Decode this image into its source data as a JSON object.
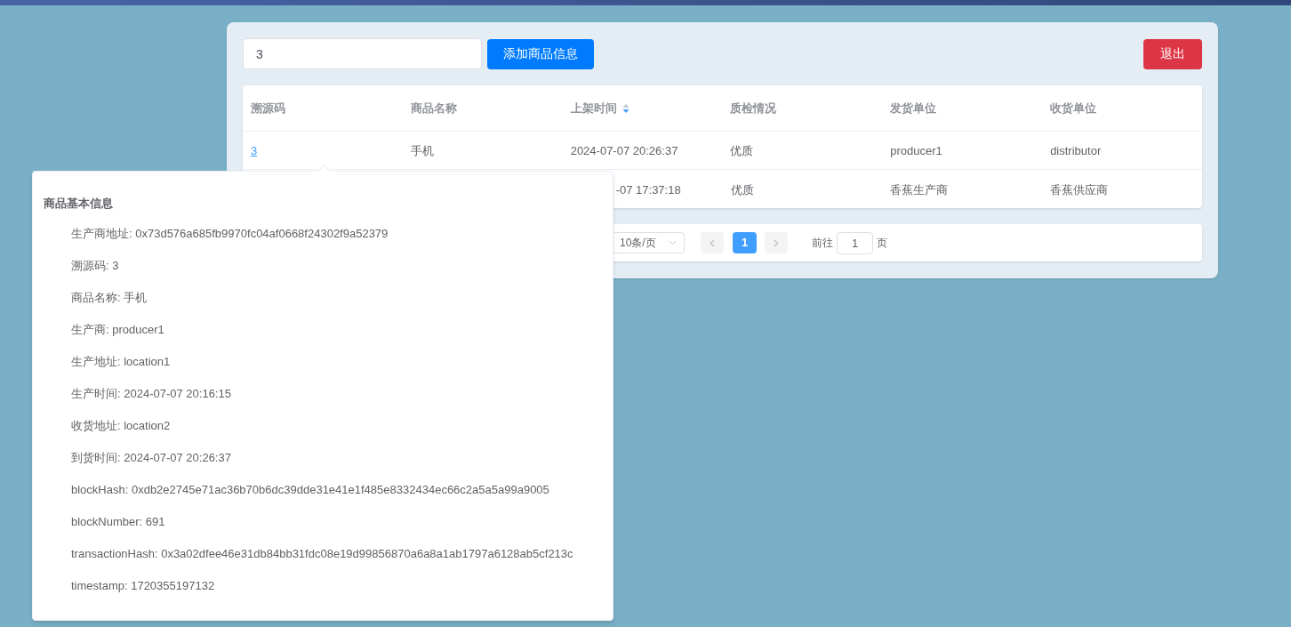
{
  "search": {
    "value": "3"
  },
  "add_button": "添加商品信息",
  "exit_button": "退出",
  "table": {
    "columns": [
      {
        "label": "溯源码"
      },
      {
        "label": "商品名称"
      },
      {
        "label": "上架时间",
        "sort_descending": true
      },
      {
        "label": "质检情况"
      },
      {
        "label": "发货单位"
      },
      {
        "label": "收货单位"
      }
    ],
    "rows": [
      {
        "cells": [
          "3",
          "手机",
          "2024-07-07 20:26:37",
          "优质",
          "producer1",
          "distributor"
        ]
      },
      {
        "cells": [
          "",
          "",
          "-07 17:37:18",
          "优质",
          "香蕉生产商",
          "香蕉供应商"
        ]
      }
    ]
  },
  "pagination": {
    "page_size": "10条/页",
    "pages": [
      {
        "label": "1",
        "selected": true
      }
    ],
    "jump_label": "前往",
    "jump_value": "1",
    "jump_suffix": "页"
  },
  "popover": {
    "title": "商品基本信息",
    "items": [
      "生产商地址: 0x73d576a685fb9970fc04af0668f24302f9a52379",
      "溯源码: 3",
      "商品名称: 手机",
      "生产商: producer1",
      "生产地址: location1",
      "生产时间: 2024-07-07 20:16:15",
      "收货地址: location2",
      "到货时间: 2024-07-07 20:26:37",
      "blockHash: 0xdb2e2745e71ac36b70b6dc39dde31e41e1f485e8332434ec66c2a5a5a99a9005",
      "blockNumber: 691",
      "transactionHash: 0x3a02dfee46e31db84bb31fdc08e19d99856870a6a8a1ab1797a6128ab5cf213c",
      "timestamp: 1720355197132"
    ]
  }
}
